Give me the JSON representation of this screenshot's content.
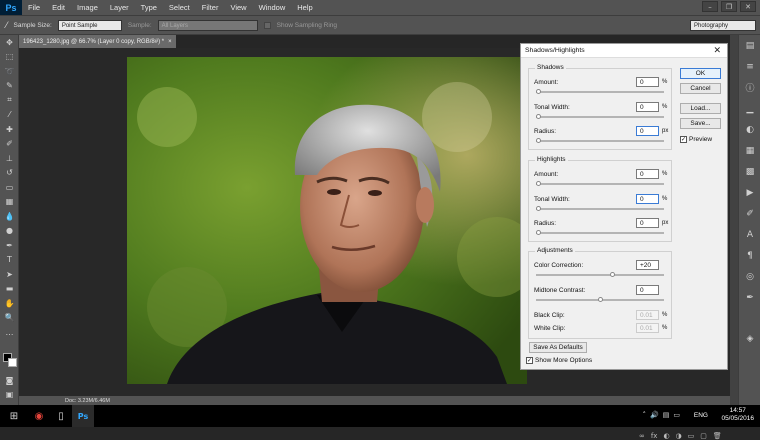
{
  "app": {
    "logo": "Ps"
  },
  "menubar": {
    "items": [
      "File",
      "Edit",
      "Image",
      "Layer",
      "Type",
      "Select",
      "Filter",
      "View",
      "Window",
      "Help"
    ]
  },
  "options": {
    "sample_size_label": "Sample Size:",
    "sample_size_value": "Point Sample",
    "sample_label": "Sample:",
    "sample_value": "All Layers",
    "sampling_ring_label": "Show Sampling Ring",
    "workspace": "Photography"
  },
  "document": {
    "tab_title": "196423_1280.jpg @ 66.7% (Layer 0 copy, RGB/8#) *",
    "tab_close": "×",
    "status_doc": "Doc: 3.23M/6.46M"
  },
  "dialog": {
    "title": "Shadows/Highlights",
    "close": "✕",
    "shadows": {
      "title": "Shadows",
      "amount_label": "Amount:",
      "amount_value": "0",
      "amount_unit": "%",
      "amount_pos": 0,
      "tonal_label": "Tonal Width:",
      "tonal_value": "0",
      "tonal_unit": "%",
      "tonal_pos": 0,
      "radius_label": "Radius:",
      "radius_value": "0",
      "radius_unit": "px",
      "radius_pos": 0
    },
    "highlights": {
      "title": "Highlights",
      "amount_label": "Amount:",
      "amount_value": "0",
      "amount_unit": "%",
      "amount_pos": 0,
      "tonal_label": "Tonal Width:",
      "tonal_value": "0",
      "tonal_unit": "%",
      "tonal_pos": 0,
      "radius_label": "Radius:",
      "radius_value": "0",
      "radius_unit": "px",
      "radius_pos": 0
    },
    "adjustments": {
      "title": "Adjustments",
      "color_label": "Color Correction:",
      "color_value": "+20",
      "color_pos": 0.6,
      "midtone_label": "Midtone Contrast:",
      "midtone_value": "0",
      "midtone_pos": 0.5,
      "black_label": "Black Clip:",
      "black_value": "0.01",
      "black_unit": "%",
      "white_label": "White Clip:",
      "white_value": "0.01",
      "white_unit": "%"
    },
    "buttons": {
      "ok": "OK",
      "cancel": "Cancel",
      "load": "Load...",
      "save": "Save...",
      "save_defaults": "Save As Defaults"
    },
    "preview_label": "Preview",
    "more_options_label": "Show More Options"
  },
  "taskbar": {
    "lang": "ENG",
    "time": "14:57",
    "date": "05/05/2016"
  }
}
